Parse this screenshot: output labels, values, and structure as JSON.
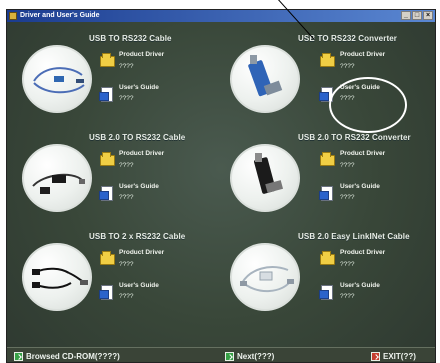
{
  "window": {
    "title": "Driver and User's Guide",
    "buttons": {
      "minimize": "_",
      "maximize": "□",
      "close": "×"
    }
  },
  "cards": [
    {
      "title": "USB  TO RS232 Cable",
      "product_driver": "Product Driver",
      "product_value": "????",
      "user_guide": "User's Guide",
      "guide_value": "????"
    },
    {
      "title": "USB TO RS232 Converter",
      "product_driver": "Product Driver",
      "product_value": "????",
      "user_guide": "User's Guide",
      "guide_value": "????"
    },
    {
      "title": "USB 2.0 TO RS232 Cable",
      "product_driver": "Product Driver",
      "product_value": "????",
      "user_guide": "User's Guide",
      "guide_value": "????"
    },
    {
      "title": "USB 2.0 TO RS232  Converter",
      "product_driver": "Product Driver",
      "product_value": "????",
      "user_guide": "User's Guide",
      "guide_value": "????"
    },
    {
      "title": "USB TO 2 x RS232 Cable",
      "product_driver": "Product Driver",
      "product_value": "????",
      "user_guide": "User's Guide",
      "guide_value": "????"
    },
    {
      "title": "USB 2.0 Easy LinkINet Cable",
      "product_driver": "Product Driver",
      "product_value": "????",
      "user_guide": "User's Guide",
      "guide_value": "????"
    }
  ],
  "footer": {
    "browse_label": "Browsed CD-ROM(????)",
    "next_label": "Next(???)",
    "exit_label": "EXIT(??)"
  },
  "icons": {
    "title": "app-icon",
    "folder": "folder-icon",
    "guide": "document-icon",
    "action": "check-icon",
    "exit": "exit-icon"
  },
  "colors": {
    "background": "#3d4a41",
    "title_bar": "#1b3c8f",
    "action_green": "#36a146",
    "exit_red": "#c43f2f"
  }
}
